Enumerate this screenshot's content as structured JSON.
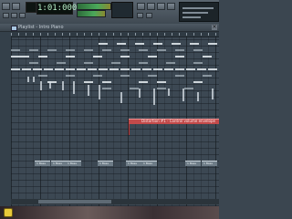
{
  "toolbar": {
    "time_display": "1:01:000"
  },
  "playlist": {
    "title": "Playlist - Intro Piano",
    "close_glyph": "×",
    "automation_clip_label": "Distortion #1 - Control volume envelope",
    "audio_clip_label": "1 Bass"
  },
  "taskbar": {
    "hint_icon": "warning-icon"
  }
}
